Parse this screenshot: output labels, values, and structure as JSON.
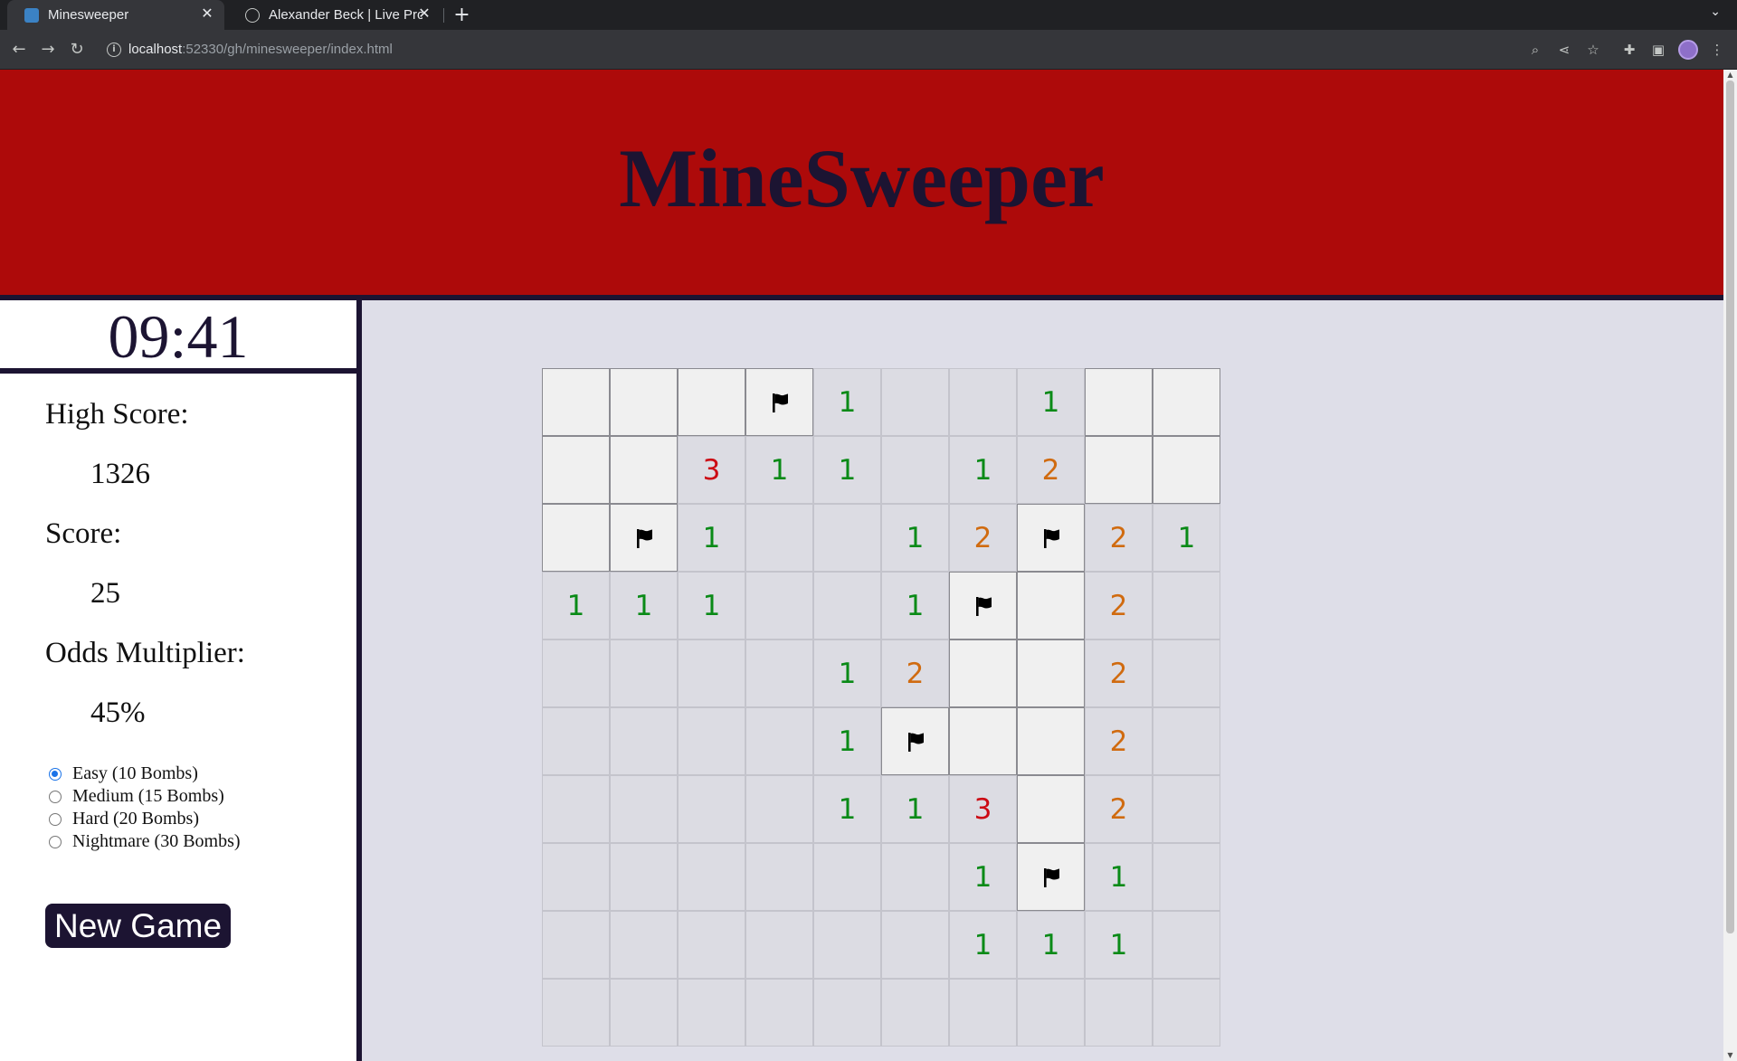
{
  "browser": {
    "tabs": [
      {
        "title": "Minesweeper",
        "active": true
      },
      {
        "title": "Alexander Beck | Live Proj",
        "active": false
      }
    ],
    "url_host": "localhost",
    "url_rest": ":52330/gh/minesweeper/index.html",
    "icons": [
      "back-icon",
      "forward-icon",
      "reload-icon",
      "zoom-icon",
      "share-icon",
      "bookmark-star-icon",
      "extensions-icon",
      "side-panel-icon",
      "profile-avatar",
      "menu-icon"
    ]
  },
  "header": {
    "title": "MineSweeper",
    "bg_color": "#ad0a0a",
    "title_color": "#1c1432"
  },
  "sidebar": {
    "timer": "09:41",
    "high_score_label": "High Score:",
    "high_score": "1326",
    "score_label": "Score:",
    "score": "25",
    "odds_label": "Odds Multiplier:",
    "odds": "45%",
    "difficulties": [
      {
        "label": "Easy (10 Bombs)",
        "checked": true
      },
      {
        "label": "Medium (15 Bombs)",
        "checked": false
      },
      {
        "label": "Hard (20 Bombs)",
        "checked": false
      },
      {
        "label": "Nightmare (30 Bombs)",
        "checked": false
      }
    ],
    "new_game_label": "New Game"
  },
  "board": {
    "legend": "H = hidden, F = flagged, E = revealed empty, digit = revealed number",
    "rows": [
      [
        "H",
        "H",
        "H",
        "F",
        "1",
        "E",
        "E",
        "1",
        "H",
        "H"
      ],
      [
        "H",
        "H",
        "3",
        "1",
        "1",
        "E",
        "1",
        "2",
        "H",
        "H"
      ],
      [
        "H",
        "F",
        "1",
        "E",
        "E",
        "1",
        "2",
        "F",
        "2",
        "1"
      ],
      [
        "1",
        "1",
        "1",
        "E",
        "E",
        "1",
        "F",
        "H",
        "2",
        "E"
      ],
      [
        "E",
        "E",
        "E",
        "E",
        "1",
        "2",
        "H",
        "H",
        "2",
        "E"
      ],
      [
        "E",
        "E",
        "E",
        "E",
        "1",
        "F",
        "H",
        "H",
        "2",
        "E"
      ],
      [
        "E",
        "E",
        "E",
        "E",
        "1",
        "1",
        "3",
        "H",
        "2",
        "E"
      ],
      [
        "E",
        "E",
        "E",
        "E",
        "E",
        "E",
        "1",
        "F",
        "1",
        "E"
      ],
      [
        "E",
        "E",
        "E",
        "E",
        "E",
        "E",
        "1",
        "1",
        "1",
        "E"
      ],
      [
        "E",
        "E",
        "E",
        "E",
        "E",
        "E",
        "E",
        "E",
        "E",
        "E"
      ]
    ],
    "number_colors": {
      "1": "#0a8a17",
      "2": "#d06b10",
      "3": "#cc0a14"
    }
  }
}
